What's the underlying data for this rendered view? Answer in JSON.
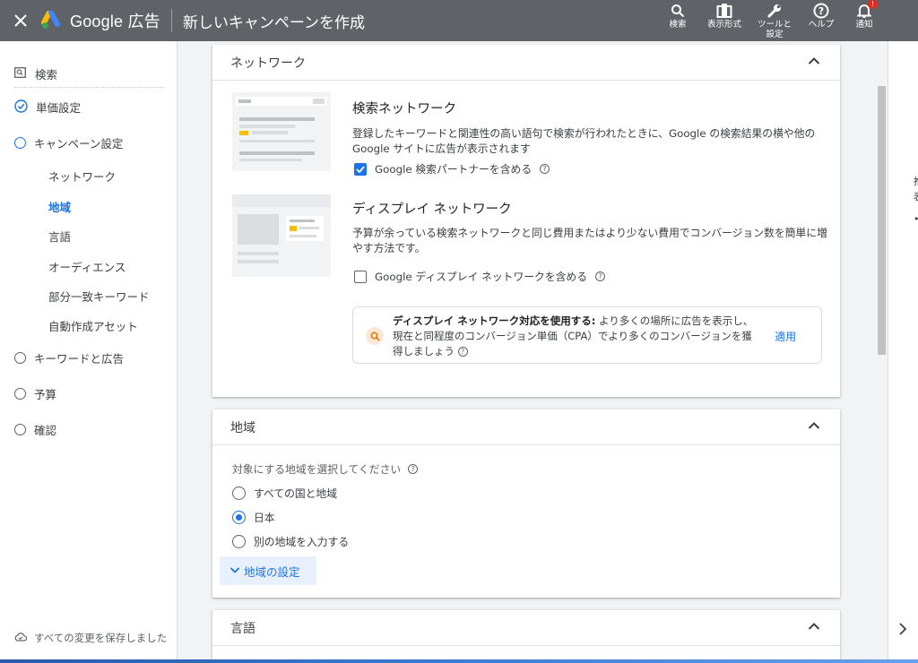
{
  "topbar": {
    "close_icon": "close-icon",
    "brand": "Google 広告",
    "page_title": "新しいキャンペーンを作成",
    "actions": [
      {
        "icon": "search-icon",
        "label": "検索"
      },
      {
        "icon": "view-icon",
        "label": "表示形式"
      },
      {
        "icon": "wrench-icon",
        "label": "ツールと\n設定"
      },
      {
        "icon": "help-icon",
        "label": "ヘルプ"
      },
      {
        "icon": "bell-icon",
        "label": "通知",
        "badge": "!"
      }
    ]
  },
  "sidenav": {
    "search_label": "検索",
    "steps": [
      {
        "label": "単価設定",
        "state": "done"
      },
      {
        "label": "キャンペーン設定",
        "state": "active"
      },
      {
        "label": "キーワードと広告",
        "state": "todo"
      },
      {
        "label": "予算",
        "state": "todo"
      },
      {
        "label": "確認",
        "state": "todo"
      }
    ],
    "sub_items": [
      "ネットワーク",
      "地域",
      "言語",
      "オーディエンス",
      "部分一致キーワード",
      "自動作成アセット"
    ],
    "current_sub": "地域",
    "save_status": "すべての変更を保存しました"
  },
  "network_card": {
    "title": "ネットワーク",
    "search": {
      "title": "検索ネットワーク",
      "desc": "登録したキーワードと関連性の高い語句で検索が行われたときに、Google の検索結果の横や他の Google サイトに広告が表示されます",
      "checkbox_label": "Google 検索パートナーを含める",
      "checked": true
    },
    "display": {
      "title": "ディスプレイ ネットワーク",
      "desc": "予算が余っている検索ネットワークと同じ費用またはより少ない費用でコンバージョン数を簡単に増やす方法です。",
      "checkbox_label": "Google ディスプレイ ネットワークを含める",
      "checked": false
    },
    "suggestion": {
      "bold": "ディスプレイ ネットワーク対応を使用する:",
      "text": " より多くの場所に広告を表示し、現在と同程度のコンバージョン単価（CPA）でより多くのコンバージョンを獲得しましょう",
      "apply": "適用"
    }
  },
  "location_card": {
    "title": "地域",
    "prompt": "対象にする地域を選択してください",
    "options": [
      "すべての国と地域",
      "日本",
      "別の地域を入力する"
    ],
    "selected": "日本",
    "settings_link": "地域の設定"
  },
  "language_card": {
    "title": "言語"
  },
  "right_panel": {
    "chars": [
      "推",
      "表",
      "•"
    ]
  },
  "colors": {
    "topbar": "#5f6368",
    "accent": "#1a73e8",
    "badge": "#d93025"
  }
}
